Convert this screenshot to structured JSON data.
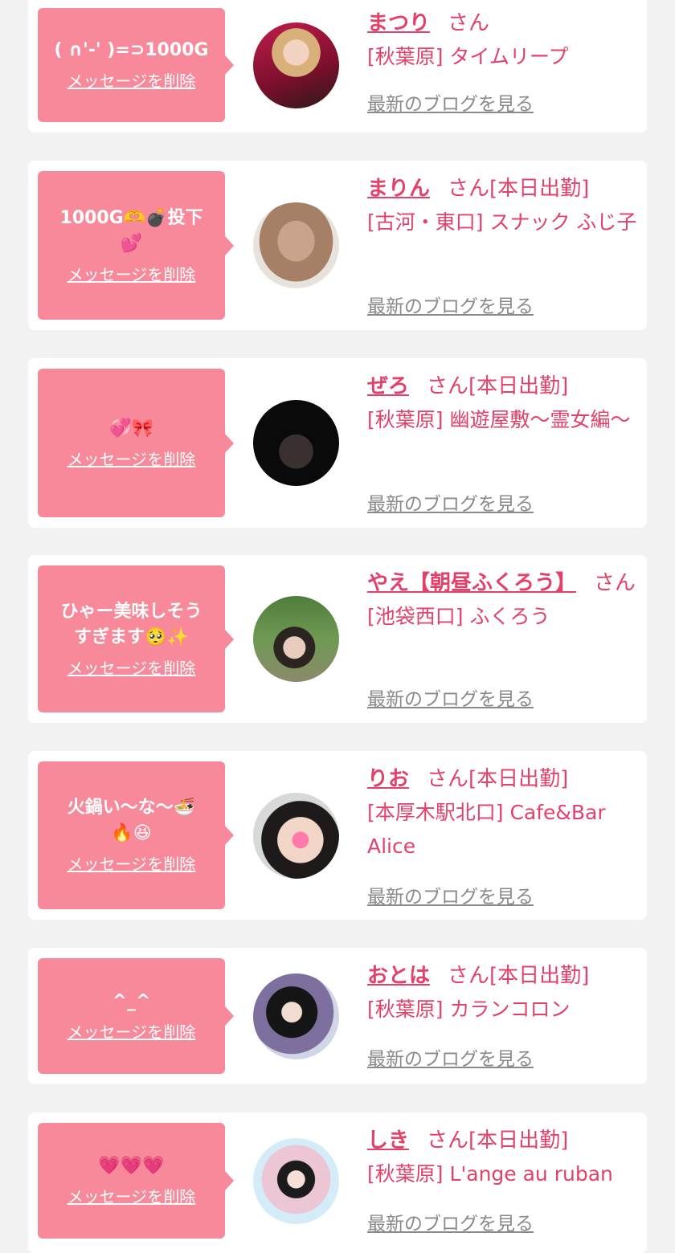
{
  "delete_label": "メッセージを削除",
  "blog_label": "最新のブログを見る",
  "honorific": "さん",
  "colors": {
    "accent": "#e4416a",
    "bubble": "#f7899a",
    "background": "#f2f2f2",
    "link_gray": "#8a8a8a"
  },
  "cards": [
    {
      "message": "( ∩'-' )=⊃1000G",
      "name": "まつり",
      "suffix": "",
      "shop": "[秋葉原] タイムリープ"
    },
    {
      "message": "1000G🫶💣投下\n💕",
      "name": "まりん",
      "suffix": "[本日出勤]",
      "shop": "[古河・東口] スナック ふじ子"
    },
    {
      "message": "💞🎀",
      "name": "ぜろ",
      "suffix": "[本日出勤]",
      "shop": "[秋葉原] 幽遊屋敷～霊女編～"
    },
    {
      "message": "ひゃー美味しそう\nすぎます🥺✨",
      "name": "やえ【朝昼ふくろう】",
      "suffix": "",
      "shop": "[池袋西口] ふくろう"
    },
    {
      "message": "火鍋い～な～🍜\n🔥😆",
      "name": "りお",
      "suffix": "[本日出勤]",
      "shop": "[本厚木駅北口] Cafe&Bar Alice"
    },
    {
      "message": "^_^",
      "name": "おとは",
      "suffix": "[本日出勤]",
      "shop": "[秋葉原] カランコロン"
    },
    {
      "message": "💗💗💗",
      "name": "しき",
      "suffix": "[本日出勤]",
      "shop": "[秋葉原] L'ange au ruban"
    }
  ]
}
